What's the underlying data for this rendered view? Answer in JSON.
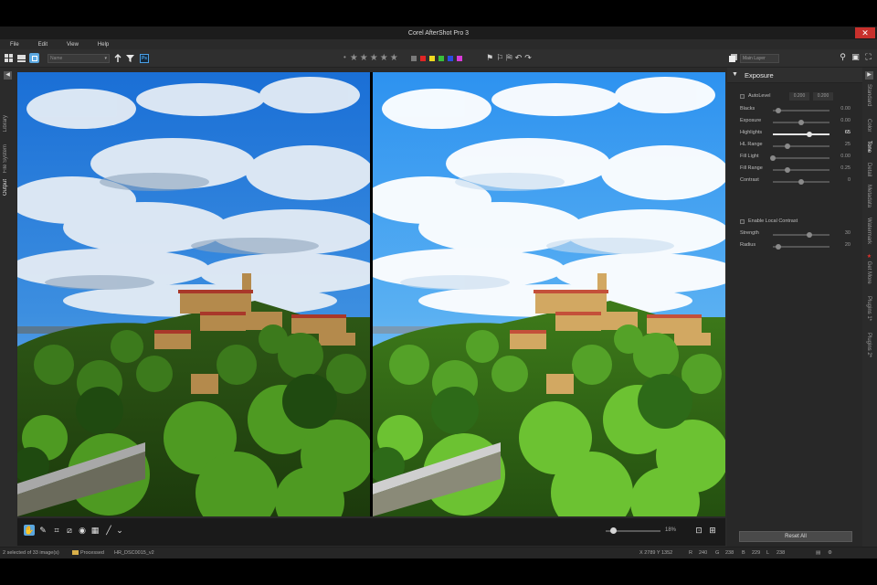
{
  "window": {
    "title": "Corel AfterShot Pro 3",
    "close_glyph": "✕"
  },
  "menu": {
    "items": [
      "File",
      "Edit",
      "View",
      "Help"
    ]
  },
  "toolbar": {
    "name_select": "Name",
    "ps_label": "Ps",
    "rating_dot": "•",
    "stars": [
      "★",
      "★",
      "★",
      "★",
      "★"
    ],
    "color_labels": [
      "#7a7a7a",
      "#e02525",
      "#f0d820",
      "#38c03a",
      "#2a4de0",
      "#d83ad8"
    ],
    "layer_select": "Main Layer",
    "icons": [
      "grid-icon",
      "single-view-icon",
      "compare-view-icon",
      "sort-icon",
      "filter-icon",
      "photoshop-icon",
      "flag-icons",
      "rotate-left-icon",
      "rotate-right-icon",
      "search-icon",
      "slideshow-icon",
      "fullscreen-icon"
    ]
  },
  "left_tabs": [
    "Library",
    "File System",
    "Output"
  ],
  "right_tabs": [
    "Standard",
    "Color",
    "Tone",
    "Detail",
    "Metadata",
    "Watermark",
    "Get More",
    "Plugins 1*",
    "Plugins 2*"
  ],
  "panel": {
    "title": "Exposure",
    "autolevel": {
      "label": "AutoLevel",
      "low": "0.200",
      "high": "0.200"
    },
    "sliders": [
      {
        "label": "Blacks",
        "value": "0.00",
        "level": 0.1,
        "highlight": false
      },
      {
        "label": "Exposure",
        "value": "0.00",
        "level": 0.5,
        "highlight": false
      },
      {
        "label": "Highlights",
        "value": "65",
        "level": 0.65,
        "highlight": true
      },
      {
        "label": "HL Range",
        "value": "25",
        "level": 0.25,
        "highlight": false
      },
      {
        "label": "Fill Light",
        "value": "0.00",
        "level": 0.0,
        "highlight": false
      },
      {
        "label": "Fill Range",
        "value": "0.25",
        "level": 0.25,
        "highlight": false
      },
      {
        "label": "Contrast",
        "value": "0",
        "level": 0.5,
        "highlight": false
      }
    ],
    "local_contrast": {
      "label": "Enable Local Contrast"
    },
    "lc_sliders": [
      {
        "label": "Strength",
        "value": "30",
        "level": 0.65
      },
      {
        "label": "Radius",
        "value": "20",
        "level": 0.1
      }
    ],
    "reset_label": "Reset All"
  },
  "viewer": {
    "zoom": "18%",
    "zoom_level": 0.08
  },
  "status": {
    "selection": "2 selected of 33 image(s)",
    "folder": "Processed",
    "filename": "HR_DSC0015_v2",
    "coords": "X 2789  Y 1352",
    "r_label": "R",
    "r": "240",
    "g_label": "G",
    "g": "238",
    "b_label": "B",
    "b": "229",
    "l_label": "L",
    "l": "238"
  }
}
